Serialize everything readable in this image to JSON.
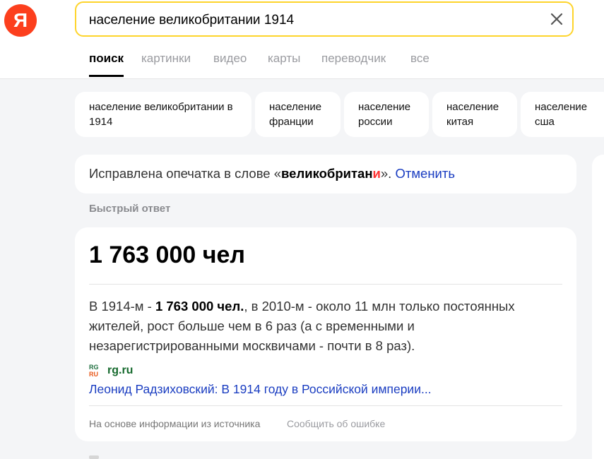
{
  "logo": {
    "letter": "Я"
  },
  "search": {
    "value": "население великобритании 1914"
  },
  "tabs": [
    {
      "label": "поиск",
      "active": true
    },
    {
      "label": "картинки"
    },
    {
      "label": "видео"
    },
    {
      "label": "карты"
    },
    {
      "label": "переводчик"
    },
    {
      "label": "все"
    }
  ],
  "chips": [
    {
      "label": "население великобритании в 1914"
    },
    {
      "label": "население франции"
    },
    {
      "label": "население россии"
    },
    {
      "label": "население китая"
    },
    {
      "label": "население сша"
    }
  ],
  "typo_notice": {
    "prefix": "Исправлена опечатка в слове «",
    "word_start": "великобритан",
    "word_fix": "и",
    "suffix": "». ",
    "cancel_label": "Отменить"
  },
  "quick_answer": {
    "section_label": "Быстрый ответ",
    "value": "1 763 000 чел",
    "snippet_1": "В 1914-м - ",
    "snippet_bold": "1 763 000 чел.",
    "snippet_2": ", в 2010-м - около 11 млн только постоянных жителей, рост больше чем в 6 раз (а с временными и незарегистрированными москвичами - почти в 8 раз).",
    "favicon_top": "RG",
    "favicon_bottom": "RU",
    "source_domain": "rg.ru",
    "source_title": "Леонид Радзиховский: В 1914 году в Российской империи...",
    "footer_note": "На основе информации из источника",
    "report_label": "Сообщить об ошибке"
  },
  "colors": {
    "logo_bg": "#fc3f1d",
    "search_border": "#fed42b",
    "link": "#1a3dc1",
    "source_green": "#166a2e",
    "typo_red": "#ff3333"
  }
}
